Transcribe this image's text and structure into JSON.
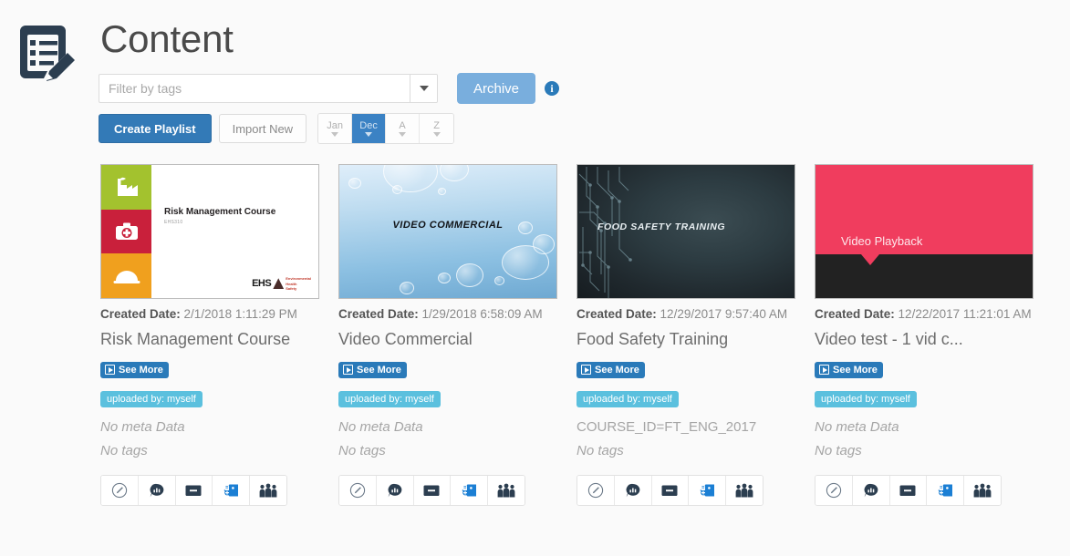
{
  "header": {
    "icon": "content-document-pencil-icon",
    "title": "Content",
    "filter": {
      "placeholder": "Filter by tags",
      "value": "",
      "caret_icon": "chevron-down-icon"
    },
    "archive_label": "Archive",
    "info_icon": "info-circle-icon",
    "create_playlist_label": "Create Playlist",
    "import_new_label": "Import New",
    "sort_buttons": [
      {
        "label": "Jan",
        "arrow": "caret-down-icon",
        "active": false
      },
      {
        "label": "Dec",
        "arrow": "caret-down-icon",
        "active": true
      },
      {
        "label": "A",
        "arrow": "caret-down-icon",
        "active": false
      },
      {
        "label": "Z",
        "arrow": "caret-down-icon",
        "active": false
      }
    ]
  },
  "labels": {
    "created_date": "Created Date:",
    "see_more": "See More",
    "no_meta": "No meta Data",
    "no_tags": "No tags"
  },
  "colors": {
    "primary_blue": "#337ab7",
    "archive_blue": "#79aedd",
    "see_more_blue": "#2a7ab9",
    "uploader_badge": "#5bc0de",
    "sort_active": "#3b82c4",
    "title_grey": "#6d6d6d",
    "meta_grey": "#a5a5a5",
    "icon_navy": "#2c3e50",
    "tag_icon_blue": "#1b7fd4"
  },
  "action_icons": [
    "edit-pencil-circle-icon",
    "comment-bubble-icon",
    "archive-box-icon",
    "tag-add-icon",
    "group-people-icon"
  ],
  "cards": [
    {
      "thumb_type": "risk-management-course",
      "thumb_title": "Risk Management Course",
      "thumb_subtitle": "EHS310",
      "thumb_logo": "EHS",
      "created_date": "2/1/2018 1:11:29 PM",
      "title": "Risk Management Course",
      "see_more": "See More",
      "uploader": "uploaded by: myself",
      "meta": "No meta Data",
      "meta_empty": true,
      "tags": "No tags",
      "tags_empty": true
    },
    {
      "thumb_type": "video-commercial",
      "thumb_title": "VIDEO COMMERCIAL",
      "created_date": "1/29/2018 6:58:09 AM",
      "title": "Video Commercial",
      "see_more": "See More",
      "uploader": "uploaded by: myself",
      "meta": "No meta Data",
      "meta_empty": true,
      "tags": "No tags",
      "tags_empty": true
    },
    {
      "thumb_type": "food-safety-training",
      "thumb_title": "FOOD SAFETY TRAINING",
      "created_date": "12/29/2017 9:57:40 AM",
      "title": "Food Safety Training",
      "see_more": "See More",
      "uploader": "uploaded by: myself",
      "meta": "COURSE_ID=FT_ENG_2017",
      "meta_empty": false,
      "tags": "No tags",
      "tags_empty": true
    },
    {
      "thumb_type": "video-playback",
      "thumb_title": "Video Playback",
      "created_date": "12/22/2017 11:21:01 AM",
      "title": "Video test - 1 vid c...",
      "see_more": "See More",
      "uploader": "uploaded by: myself",
      "meta": "No meta Data",
      "meta_empty": true,
      "tags": "No tags",
      "tags_empty": true
    }
  ]
}
